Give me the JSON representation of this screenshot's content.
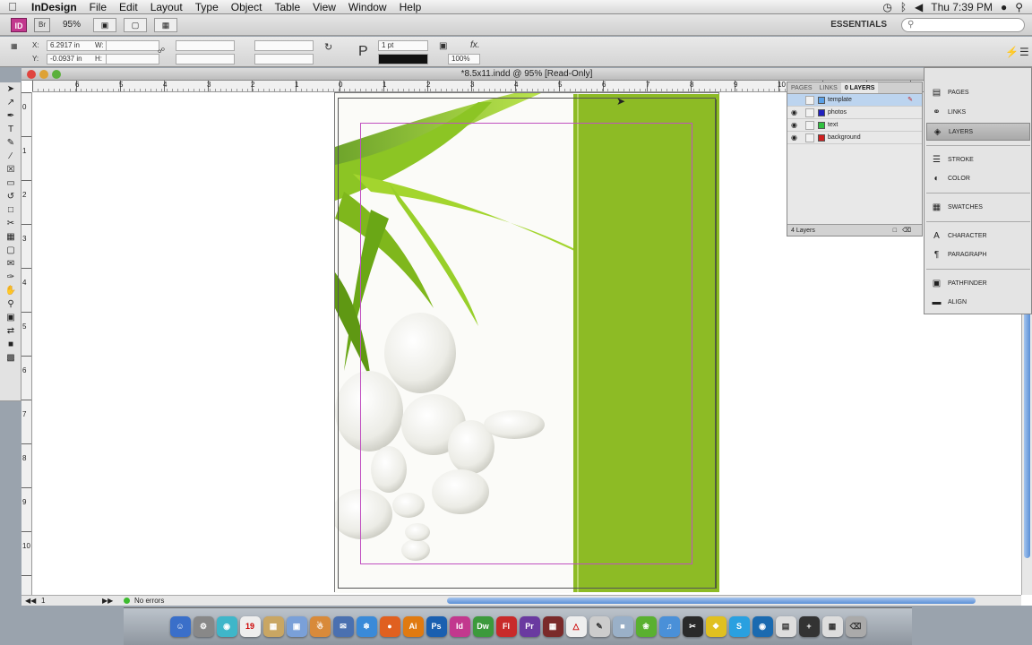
{
  "menubar": {
    "app": "InDesign",
    "items": [
      "File",
      "Edit",
      "Layout",
      "Type",
      "Object",
      "Table",
      "View",
      "Window",
      "Help"
    ],
    "clock": "Thu 7:39 PM"
  },
  "appbar": {
    "zoom": "95%",
    "workspace": "ESSENTIALS",
    "id_logo": "ID",
    "br_logo": "Br"
  },
  "control": {
    "x": "6.2917 in",
    "y": "-0.0937 in",
    "x_label": "X:",
    "y_label": "Y:",
    "w_label": "W:",
    "h_label": "H:",
    "stroke": "1 pt",
    "opacity": "100%"
  },
  "document": {
    "title": "*8.5x11.indd @ 95% [Read-Only]",
    "ruler_h": [
      "6",
      "5",
      "4",
      "3",
      "2",
      "1",
      "0",
      "1",
      "2",
      "3",
      "4",
      "5",
      "6",
      "7",
      "8",
      "9",
      "10"
    ],
    "ruler_v": [
      "0",
      "1",
      "2",
      "3",
      "4",
      "5",
      "6",
      "7",
      "8",
      "9",
      "10"
    ],
    "page_number": "1",
    "preflight": "No errors",
    "accent": "#8dbb25"
  },
  "layers_panel": {
    "tabs": [
      "PAGES",
      "LINKS",
      "0 LAYERS"
    ],
    "rows": [
      {
        "name": "template",
        "color": "#5aa0e6"
      },
      {
        "name": "photos",
        "color": "#2020c0"
      },
      {
        "name": "text",
        "color": "#30c040"
      },
      {
        "name": "background",
        "color": "#d02020"
      }
    ],
    "footer": "4 Layers"
  },
  "side_panel": {
    "items": [
      {
        "label": "PAGES",
        "icon": "pages-icon"
      },
      {
        "label": "LINKS",
        "icon": "links-icon"
      },
      {
        "label": "LAYERS",
        "icon": "layers-icon"
      },
      {
        "label": "STROKE",
        "icon": "stroke-icon"
      },
      {
        "label": "COLOR",
        "icon": "color-icon"
      },
      {
        "label": "SWATCHES",
        "icon": "swatches-icon"
      },
      {
        "label": "CHARACTER",
        "icon": "character-icon"
      },
      {
        "label": "PARAGRAPH",
        "icon": "paragraph-icon"
      },
      {
        "label": "PATHFINDER",
        "icon": "pathfinder-icon"
      },
      {
        "label": "ALIGN",
        "icon": "align-icon"
      }
    ]
  },
  "dock": {
    "apps": [
      "Ai",
      "Ps",
      "Id",
      "Dw",
      "Fl",
      "Pr"
    ],
    "calendar_day": "19"
  }
}
